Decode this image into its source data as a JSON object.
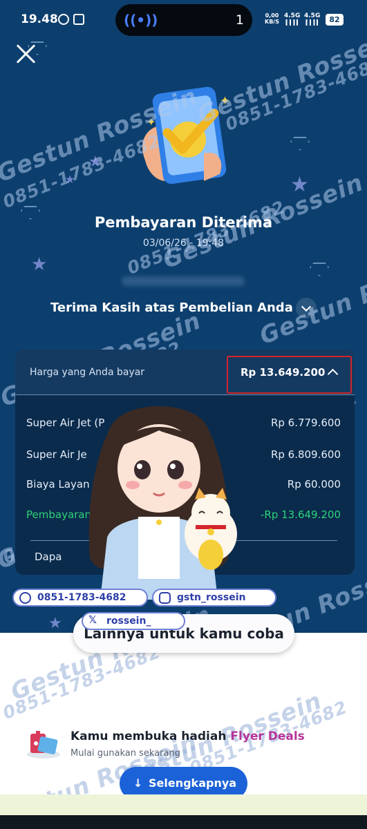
{
  "status_bar": {
    "time": "19.48",
    "dynamic_island_count": "1",
    "net_speed_value": "0,00",
    "net_speed_unit": "KB/S",
    "signal_1": "4.5G",
    "signal_2": "4.5G",
    "battery": "82"
  },
  "receipt": {
    "title": "Pembayaran Diterima",
    "datetime": "03/06/26 - 19:48",
    "thanks_heading": "Terima Kasih atas Pembelian Anda",
    "paid_label": "Harga yang Anda bayar",
    "paid_amount": "Rp 13.649.200",
    "line_items": [
      {
        "label": "Super Air Jet (P",
        "amount": "Rp 6.779.600"
      },
      {
        "label": "Super Air Je",
        "amount": "Rp 6.809.600"
      },
      {
        "label": "Biaya Layan",
        "amount": "Rp 60.000"
      },
      {
        "label": "Pembayaran",
        "amount": "-Rp 13.649.200"
      }
    ],
    "partial_row": "Dapa"
  },
  "watermark": {
    "brand": "Gestun Rossein",
    "phone": "0851-1783-4682",
    "whatsapp": "0851-1783-4682",
    "instagram": "gstn_rossein",
    "x_handle": "rossein_"
  },
  "bottom_sheet": {
    "try_label": "Lainnya untuk kamu coba",
    "promo_title_prefix": "Kamu membuka hadiah",
    "promo_title_accent": "Flyer Deals",
    "promo_subtitle": "Mulai gunakan sekarang",
    "more_button": "Selengkapnya",
    "more_button_icon": "↓"
  },
  "colors": {
    "background": "#0d3f6e",
    "highlight_border": "#d3252b",
    "discount_green": "#2fd37a",
    "accent_pink": "#b5359a",
    "primary_button": "#1b62d8"
  },
  "icons": [
    "close-icon",
    "success-phone-icon",
    "chevron-down-icon",
    "chevron-up-icon",
    "whatsapp-icon",
    "instagram-icon",
    "x-icon",
    "gift-icon",
    "arrow-down-icon"
  ]
}
